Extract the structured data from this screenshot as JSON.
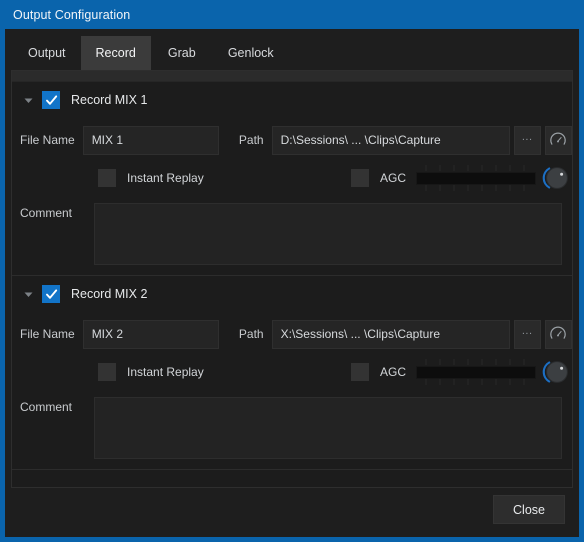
{
  "window": {
    "title": "Output Configuration",
    "accent_color": "#0a64ac",
    "background_color": "#1e1e1e"
  },
  "tabs": [
    {
      "label": "Output",
      "active": false
    },
    {
      "label": "Record",
      "active": true
    },
    {
      "label": "Grab",
      "active": false
    },
    {
      "label": "Genlock",
      "active": false
    }
  ],
  "sections": [
    {
      "title": "Record MIX 1",
      "enabled": true,
      "collapse_icon": "triangle-down-icon",
      "filename_label": "File Name",
      "filename_value": "MIX 1",
      "path_label": "Path",
      "path_value": "D:\\Sessions\\ ... \\Clips\\Capture",
      "browse_label": "...",
      "gauge_icon": "gauge-icon",
      "instant_replay_label": "Instant Replay",
      "instant_replay_checked": false,
      "agc_label": "AGC",
      "agc_checked": false,
      "comment_label": "Comment",
      "comment_value": ""
    },
    {
      "title": "Record MIX 2",
      "enabled": true,
      "collapse_icon": "triangle-down-icon",
      "filename_label": "File Name",
      "filename_value": "MIX 2",
      "path_label": "Path",
      "path_value": "X:\\Sessions\\ ... \\Clips\\Capture",
      "browse_label": "...",
      "gauge_icon": "gauge-icon",
      "instant_replay_label": "Instant Replay",
      "instant_replay_checked": false,
      "agc_label": "AGC",
      "agc_checked": false,
      "comment_label": "Comment",
      "comment_value": ""
    }
  ],
  "footer": {
    "close_label": "Close"
  }
}
